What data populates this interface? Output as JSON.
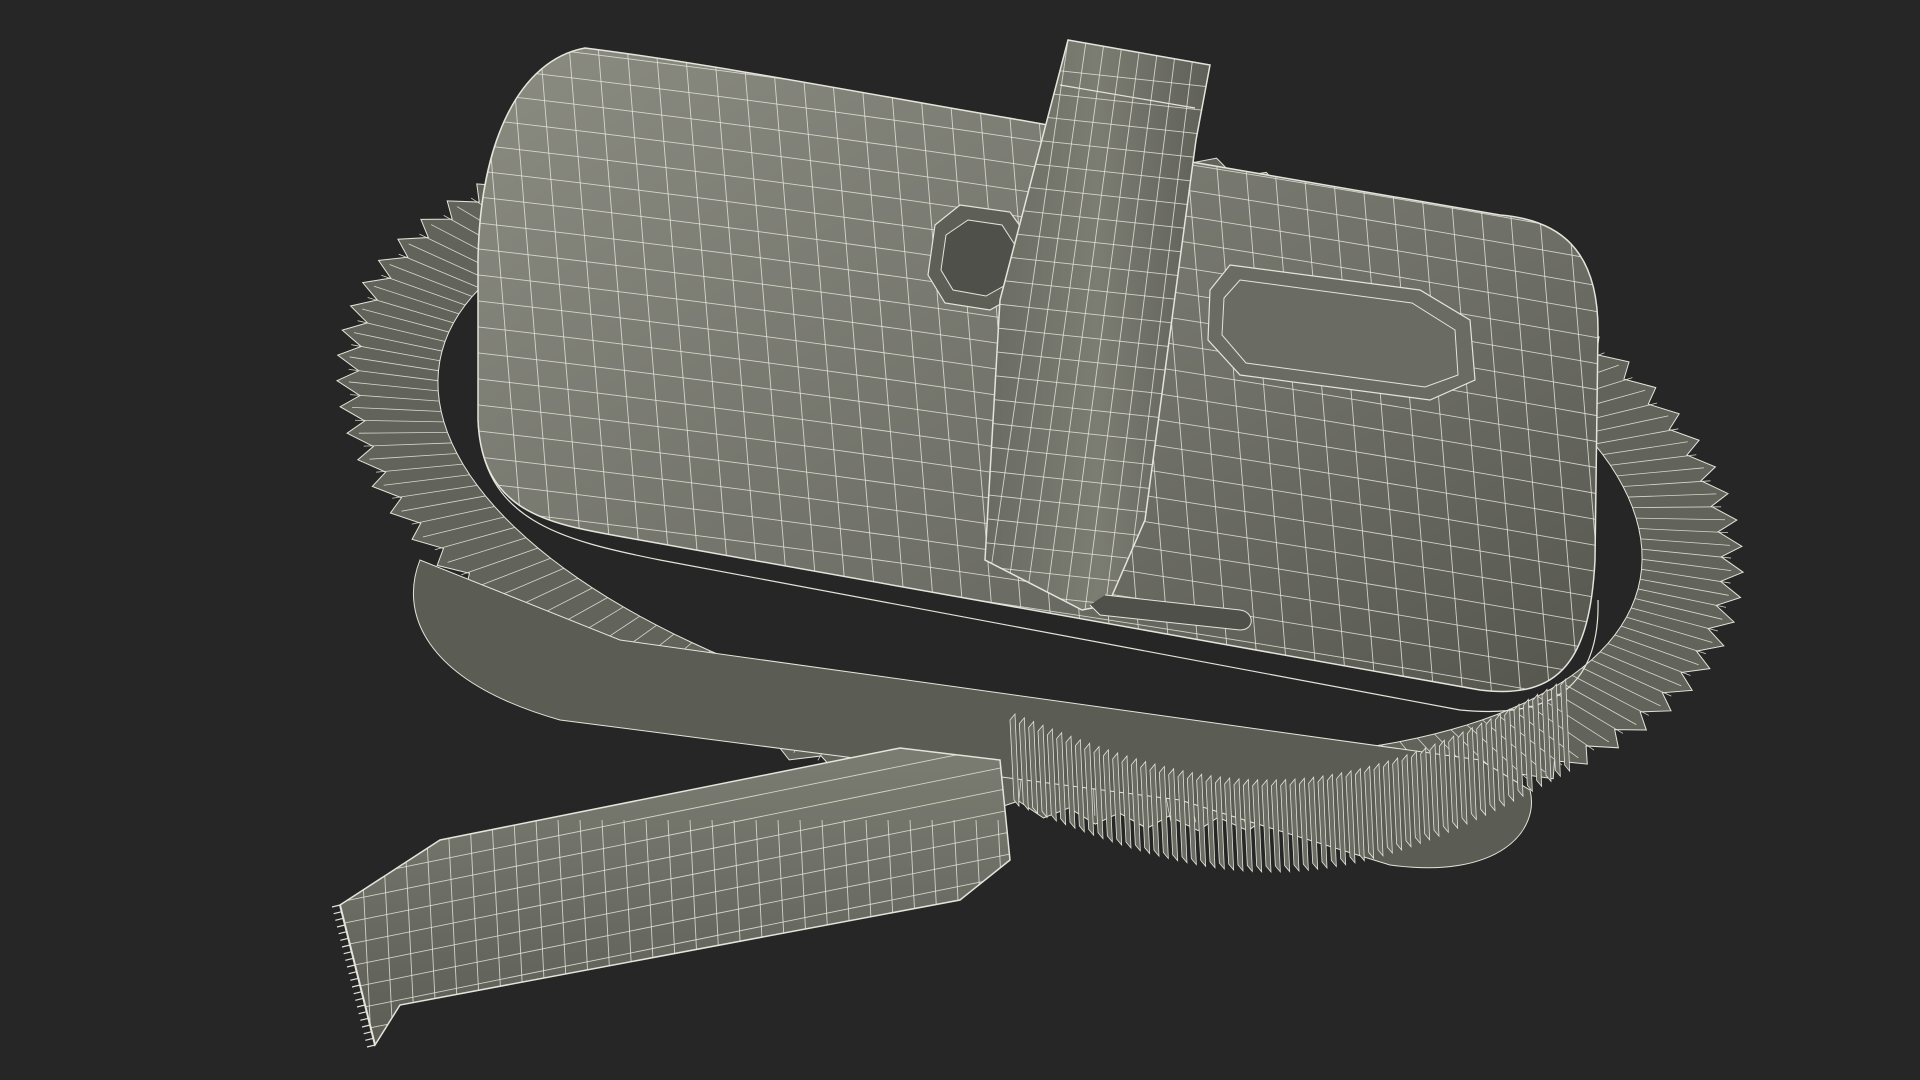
{
  "scene": {
    "subject": "wireframe-render-handheld-vacuum-with-hose",
    "colors": {
      "background": "#262626",
      "surface": "#6e6f66",
      "surface_light": "#84857b",
      "surface_dark": "#55564e",
      "wire": "#e4e4da"
    }
  }
}
